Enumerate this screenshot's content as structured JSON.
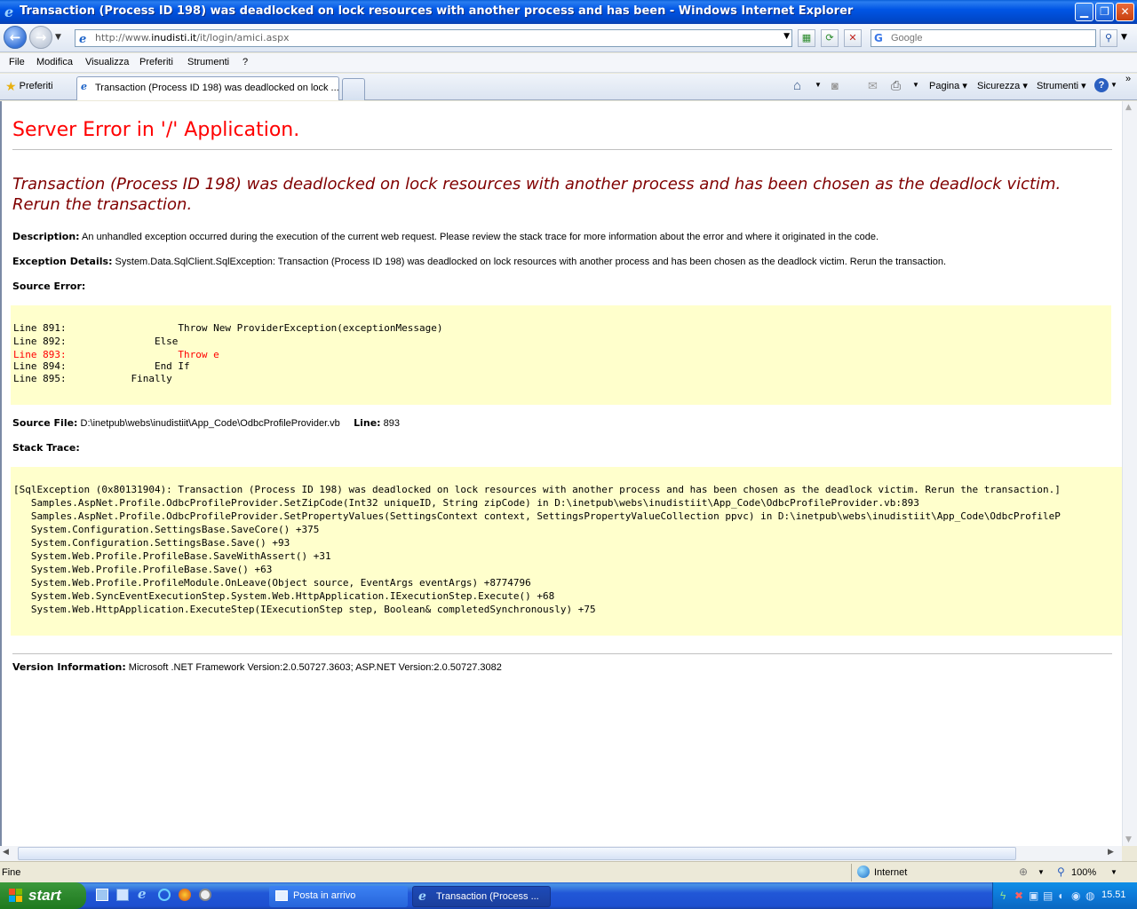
{
  "window": {
    "title": "Transaction (Process ID 198) was deadlocked on lock resources with another process and has been - Windows Internet Explorer"
  },
  "address": {
    "url_prefix": "http://www.",
    "url_domain": "inudisti.it",
    "url_path": "/it/login/amici.aspx",
    "search_placeholder": "Google"
  },
  "menu": [
    "File",
    "Modifica",
    "Visualizza",
    "Preferiti",
    "Strumenti",
    "?"
  ],
  "tabs": {
    "favorites_label": "Preferiti",
    "active_tab": "Transaction (Process ID 198) was deadlocked on lock ..."
  },
  "commands": {
    "page": "Pagina",
    "security": "Sicurezza",
    "tools": "Strumenti"
  },
  "page": {
    "heading": "Server Error in '/' Application.",
    "error_title": "Transaction (Process ID 198) was deadlocked on lock resources with another process and has been chosen as the deadlock victim. Rerun the transaction.",
    "description_label": "Description:",
    "description_text": "An unhandled exception occurred during the execution of the current web request. Please review the stack trace for more information about the error and where it originated in the code.",
    "exception_label": "Exception Details:",
    "exception_text": "System.Data.SqlClient.SqlException: Transaction (Process ID 198) was deadlocked on lock resources with another process and has been chosen as the deadlock victim. Rerun the transaction.",
    "source_error_label": "Source Error:",
    "source_lines": [
      "Line 891:                   Throw New ProviderException(exceptionMessage)",
      "Line 892:               Else",
      "Line 893:                   Throw e",
      "Line 894:               End If",
      "Line 895:           Finally"
    ],
    "source_file_label": "Source File:",
    "source_file_value": "D:\\inetpub\\webs\\inudistiit\\App_Code\\OdbcProfileProvider.vb",
    "line_label": "Line:",
    "line_value": "893",
    "stack_trace_label": "Stack Trace:",
    "stack_lines": [
      "[SqlException (0x80131904): Transaction (Process ID 198) was deadlocked on lock resources with another process and has been chosen as the deadlock victim. Rerun the transaction.]",
      "   Samples.AspNet.Profile.OdbcProfileProvider.SetZipCode(Int32 uniqueID, String zipCode) in D:\\inetpub\\webs\\inudistiit\\App_Code\\OdbcProfileProvider.vb:893",
      "   Samples.AspNet.Profile.OdbcProfileProvider.SetPropertyValues(SettingsContext context, SettingsPropertyValueCollection ppvc) in D:\\inetpub\\webs\\inudistiit\\App_Code\\OdbcProfileP",
      "   System.Configuration.SettingsBase.SaveCore() +375",
      "   System.Configuration.SettingsBase.Save() +93",
      "   System.Web.Profile.ProfileBase.SaveWithAssert() +31",
      "   System.Web.Profile.ProfileBase.Save() +63",
      "   System.Web.Profile.ProfileModule.OnLeave(Object source, EventArgs eventArgs) +8774796",
      "   System.Web.SyncEventExecutionStep.System.Web.HttpApplication.IExecutionStep.Execute() +68",
      "   System.Web.HttpApplication.ExecuteStep(IExecutionStep step, Boolean& completedSynchronously) +75"
    ],
    "version_label": "Version Information:",
    "version_text": "Microsoft .NET Framework Version:2.0.50727.3603; ASP.NET Version:2.0.50727.3082"
  },
  "status": {
    "text": "Fine",
    "zone": "Internet",
    "zoom": "100%"
  },
  "taskbar": {
    "start": "start",
    "task1": "Posta in arrivo",
    "task2": "Transaction (Process ...",
    "clock": "15.51"
  },
  "colors": {
    "error_red": "#ff0000",
    "error_maroon": "#800000",
    "code_bg": "#ffffcc"
  }
}
